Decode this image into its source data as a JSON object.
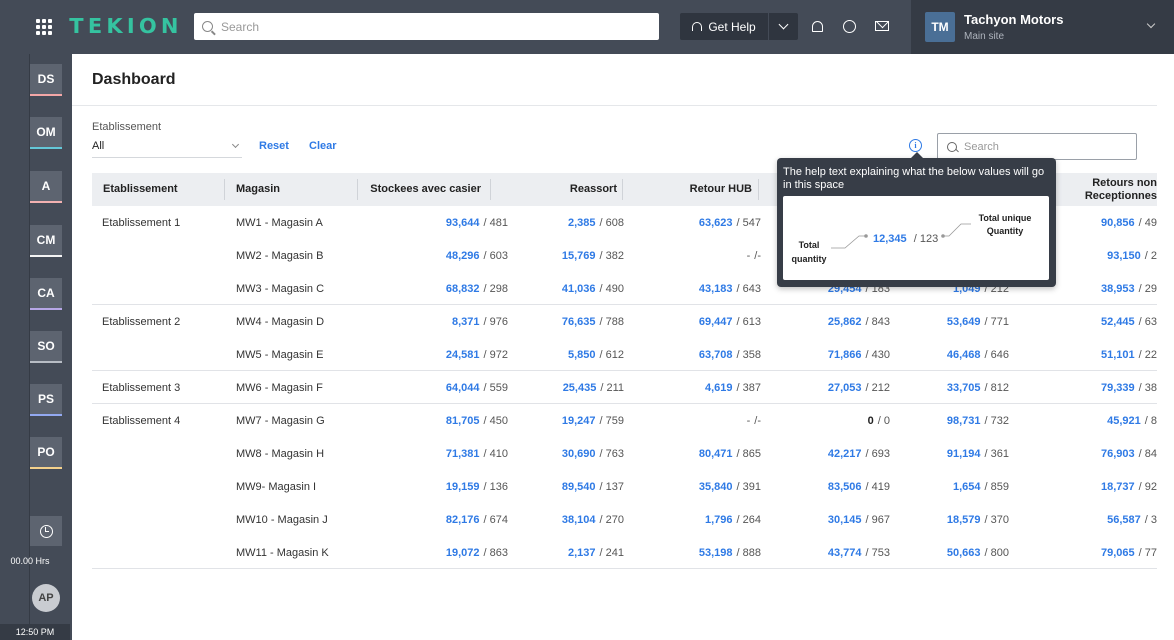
{
  "topbar": {
    "brand": "TEKION",
    "search_placeholder": "Search",
    "help_label": "Get Help",
    "dealer": {
      "initials": "TM",
      "name": "Tachyon Motors",
      "site": "Main site"
    }
  },
  "sidebar": {
    "items": [
      {
        "label": "DS",
        "accent": "#f4a7a7"
      },
      {
        "label": "OM",
        "accent": "#64c7d8"
      },
      {
        "label": "A",
        "accent": "#f3b1b1"
      },
      {
        "label": "CM",
        "accent": "#f4f4f4"
      },
      {
        "label": "CA",
        "accent": "#b7a7e7"
      },
      {
        "label": "SO",
        "accent": "#b7bcc4"
      },
      {
        "label": "PS",
        "accent": "#93a9f1"
      },
      {
        "label": "PO",
        "accent": "#f4d18c"
      }
    ],
    "hours": "00.00 Hrs",
    "user_initials": "AP",
    "time": "12:50 PM"
  },
  "page": {
    "title": "Dashboard",
    "filter_label": "Etablissement",
    "filter_value": "All",
    "reset_label": "Reset",
    "clear_label": "Clear",
    "search_placeholder": "Search"
  },
  "table": {
    "headers": [
      "Etablissement",
      "Magasin",
      "Stockees avec casier",
      "Reassort",
      "Retour HUB",
      "Retours non Receptionnes"
    ],
    "rows": [
      {
        "etab": "Etablissement 1",
        "mag": "MW1 - Magasin A",
        "c1": [
          "93,644",
          "/ 481"
        ],
        "c2": [
          "2,385",
          "/ 608"
        ],
        "c3": [
          "63,623",
          "/ 547"
        ],
        "c4": [
          "",
          ""
        ],
        "c5": [
          "",
          ""
        ],
        "c6": [
          "90,856",
          "/ 49"
        ]
      },
      {
        "etab": "",
        "mag": "MW2 - Magasin B",
        "c1": [
          "48,296",
          "/ 603"
        ],
        "c2": [
          "15,769",
          "/ 382"
        ],
        "c3": [
          "-",
          "/-"
        ],
        "c4": [
          "",
          ""
        ],
        "c5": [
          "",
          ""
        ],
        "c6": [
          "93,150",
          "/ 2"
        ]
      },
      {
        "etab": "",
        "mag": "MW3 - Magasin C",
        "c1": [
          "68,832",
          "/ 298"
        ],
        "c2": [
          "41,036",
          "/ 490"
        ],
        "c3": [
          "43,183",
          "/ 643"
        ],
        "c4": [
          "29,454",
          "/ 183"
        ],
        "c5": [
          "1,049",
          "/ 212"
        ],
        "c6": [
          "38,953",
          "/ 29"
        ]
      },
      {
        "etab": "Etablissement 2",
        "mag": "MW4 - Magasin D",
        "c1": [
          "8,371",
          "/ 976"
        ],
        "c2": [
          "76,635",
          "/ 788"
        ],
        "c3": [
          "69,447",
          "/ 613"
        ],
        "c4": [
          "25,862",
          "/ 843"
        ],
        "c5": [
          "53,649",
          "/ 771"
        ],
        "c6": [
          "52,445",
          "/ 63"
        ]
      },
      {
        "etab": "",
        "mag": "MW5 - Magasin E",
        "c1": [
          "24,581",
          "/ 972"
        ],
        "c2": [
          "5,850",
          "/ 612"
        ],
        "c3": [
          "63,708",
          "/ 358"
        ],
        "c4": [
          "71,866",
          "/ 430"
        ],
        "c5": [
          "46,468",
          "/ 646"
        ],
        "c6": [
          "51,101",
          "/ 22"
        ]
      },
      {
        "etab": "Etablissement 3",
        "mag": "MW6 - Magasin F",
        "c1": [
          "64,044",
          "/ 559"
        ],
        "c2": [
          "25,435",
          "/ 211"
        ],
        "c3": [
          "4,619",
          "/ 387"
        ],
        "c4": [
          "27,053",
          "/ 212"
        ],
        "c5": [
          "33,705",
          "/ 812"
        ],
        "c6": [
          "79,339",
          "/ 38"
        ]
      },
      {
        "etab": "Etablissement 4",
        "mag": "MW7 - Magasin G",
        "c1": [
          "81,705",
          "/ 450"
        ],
        "c2": [
          "19,247",
          "/ 759"
        ],
        "c3": [
          "-",
          "/-"
        ],
        "c4": [
          "0",
          "/ 0"
        ],
        "c5": [
          "98,731",
          "/ 732"
        ],
        "c6": [
          "45,921",
          "/ 8"
        ]
      },
      {
        "etab": "",
        "mag": "MW8 - Magasin H",
        "c1": [
          "71,381",
          "/ 410"
        ],
        "c2": [
          "30,690",
          "/ 763"
        ],
        "c3": [
          "80,471",
          "/ 865"
        ],
        "c4": [
          "42,217",
          "/ 693"
        ],
        "c5": [
          "91,194",
          "/ 361"
        ],
        "c6": [
          "76,903",
          "/ 84"
        ]
      },
      {
        "etab": "",
        "mag": "MW9- Magasin I",
        "c1": [
          "19,159",
          "/ 136"
        ],
        "c2": [
          "89,540",
          "/ 137"
        ],
        "c3": [
          "35,840",
          "/ 391"
        ],
        "c4": [
          "83,506",
          "/ 419"
        ],
        "c5": [
          "1,654",
          "/ 859"
        ],
        "c6": [
          "18,737",
          "/ 92"
        ]
      },
      {
        "etab": "",
        "mag": "MW10 - Magasin J",
        "c1": [
          "82,176",
          "/ 674"
        ],
        "c2": [
          "38,104",
          "/ 270"
        ],
        "c3": [
          "1,796",
          "/ 264"
        ],
        "c4": [
          "30,145",
          "/ 967"
        ],
        "c5": [
          "18,579",
          "/ 370"
        ],
        "c6": [
          "56,587",
          "/ 3"
        ]
      },
      {
        "etab": "",
        "mag": "MW11 - Magasin K",
        "c1": [
          "19,072",
          "/ 863"
        ],
        "c2": [
          "2,137",
          "/ 241"
        ],
        "c3": [
          "53,198",
          "/ 888"
        ],
        "c4": [
          "43,774",
          "/ 753"
        ],
        "c5": [
          "50,663",
          "/ 800"
        ],
        "c6": [
          "79,065",
          "/ 77"
        ]
      }
    ]
  },
  "tooltip": {
    "text": "The help text explaining what the below values will go in this space",
    "value": "12,345",
    "count": "/ 123",
    "label_total": "Total quantity",
    "label_unique": "Total unique Quantity"
  }
}
